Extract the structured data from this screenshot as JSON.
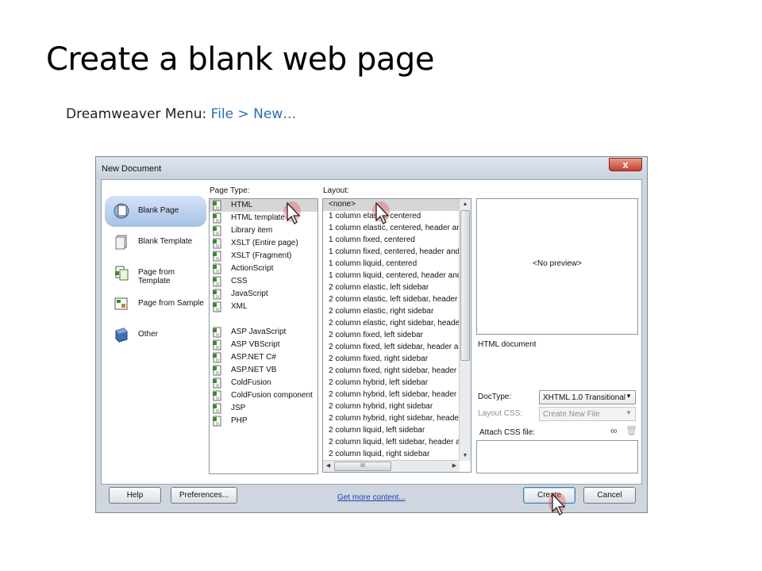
{
  "slide": {
    "title": "Create a blank web page",
    "subtitle_prefix": "Dreamweaver Menu: ",
    "subtitle_path": "File > New…"
  },
  "dialog": {
    "title": "New Document",
    "close_glyph": "x",
    "categories": [
      {
        "label": "Blank Page",
        "icon": "blank-page-icon",
        "selected": true
      },
      {
        "label": "Blank Template",
        "icon": "blank-template-icon",
        "selected": false
      },
      {
        "label": "Page from Template",
        "icon": "page-from-template-icon",
        "selected": false
      },
      {
        "label": "Page from Sample",
        "icon": "page-from-sample-icon",
        "selected": false
      },
      {
        "label": "Other",
        "icon": "other-icon",
        "selected": false
      }
    ],
    "page_type_label": "Page Type:",
    "page_types": [
      "HTML",
      "HTML template",
      "Library item",
      "XSLT (Entire page)",
      "XSLT (Fragment)",
      "ActionScript",
      "CSS",
      "JavaScript",
      "XML",
      "ASP JavaScript",
      "ASP VBScript",
      "ASP.NET C#",
      "ASP.NET VB",
      "ColdFusion",
      "ColdFusion component",
      "JSP",
      "PHP"
    ],
    "page_type_selected": "HTML",
    "layout_label": "Layout:",
    "layouts": [
      "<none>",
      "1 column elastic, centered",
      "1 column elastic, centered, header and",
      "1 column fixed, centered",
      "1 column fixed, centered, header and f",
      "1 column liquid, centered",
      "1 column liquid, centered, header and f",
      "2 column elastic, left sidebar",
      "2 column elastic, left sidebar, header a",
      "2 column elastic, right sidebar",
      "2 column elastic, right sidebar, header",
      "2 column fixed, left sidebar",
      "2 column fixed, left sidebar, header an",
      "2 column fixed, right sidebar",
      "2 column fixed, right sidebar, header a",
      "2 column hybrid, left sidebar",
      "2 column hybrid, left sidebar, header a",
      "2 column hybrid, right sidebar",
      "2 column hybrid, right sidebar, header",
      "2 column liquid, left sidebar",
      "2 column liquid, left sidebar, header an",
      "2 column liquid, right sidebar"
    ],
    "layout_selected": "<none>",
    "scroll_grip": "III",
    "preview_text": "<No preview>",
    "description": "HTML document",
    "doctype_label": "DocType:",
    "doctype_value": "XHTML 1.0 Transitional",
    "layout_css_label": "Layout CSS:",
    "layout_css_value": "Create New File",
    "attach_css_label": "Attach CSS file:",
    "buttons": {
      "help": "Help",
      "preferences": "Preferences...",
      "get_more": "Get more content...",
      "create": "Create",
      "cancel": "Cancel"
    }
  },
  "colors": {
    "accent_blue": "#2a6fb8",
    "close_red": "#c7402c",
    "selection_blue": "#a6c0e6",
    "link_blue": "#1f3fb3",
    "cursor_highlight": "#e8434a"
  }
}
